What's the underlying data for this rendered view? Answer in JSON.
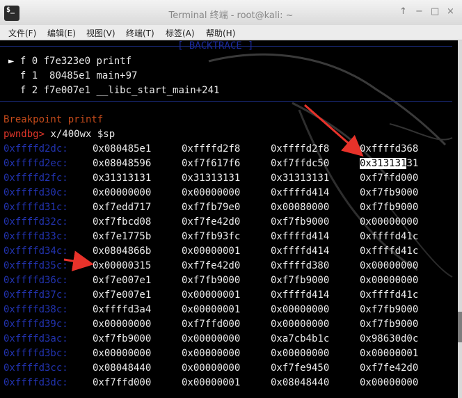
{
  "window": {
    "title": "Terminal 终端 - root@kali: ~",
    "app_icon_label": "$_",
    "controls": [
      "↑",
      "−",
      "□",
      "×"
    ]
  },
  "menu": [
    "文件(F)",
    "编辑(E)",
    "视图(V)",
    "终端(T)",
    "标签(A)",
    "帮助(H)"
  ],
  "backtrace": {
    "title": "[ BACKTRACE ]",
    "frames": [
      {
        "marker": "►",
        "text": " f 0 f7e323e0 printf"
      },
      {
        "marker": " ",
        "text": " f 1  80485e1 main+97"
      },
      {
        "marker": " ",
        "text": " f 2 f7e007e1 __libc_start_main+241"
      }
    ]
  },
  "breakpoint_text": "Breakpoint printf",
  "prompt": "pwndbg>",
  "command": " x/400wx $sp",
  "highlight": {
    "selected": "0x313131",
    "rest": "31"
  },
  "memory": [
    {
      "addr": "0xffffd2dc:",
      "words": [
        "0x080485e1",
        "0xffffd2f8",
        "0xffffd2f8",
        "0xffffd368"
      ]
    },
    {
      "addr": "0xffffd2ec:",
      "words": [
        "0x08048596",
        "0xf7f617f6",
        "0xf7ffdc50",
        "0x31313131"
      ]
    },
    {
      "addr": "0xffffd2fc:",
      "words": [
        "0x31313131",
        "0x31313131",
        "0x31313131",
        "0xf7ffd000"
      ]
    },
    {
      "addr": "0xffffd30c:",
      "words": [
        "0x00000000",
        "0x00000000",
        "0xffffd414",
        "0xf7fb9000"
      ]
    },
    {
      "addr": "0xffffd31c:",
      "words": [
        "0xf7edd717",
        "0xf7fb79e0",
        "0x00080000",
        "0xf7fb9000"
      ]
    },
    {
      "addr": "0xffffd32c:",
      "words": [
        "0xf7fbcd08",
        "0xf7fe42d0",
        "0xf7fb9000",
        "0x00000000"
      ]
    },
    {
      "addr": "0xffffd33c:",
      "words": [
        "0xf7e1775b",
        "0xf7fb93fc",
        "0xffffd414",
        "0xffffd41c"
      ]
    },
    {
      "addr": "0xffffd34c:",
      "words": [
        "0x0804866b",
        "0x00000001",
        "0xffffd414",
        "0xffffd41c"
      ]
    },
    {
      "addr": "0xffffd35c:",
      "words": [
        "0x00000315",
        "0xf7fe42d0",
        "0xffffd380",
        "0x00000000"
      ]
    },
    {
      "addr": "0xffffd36c:",
      "words": [
        "0xf7e007e1",
        "0xf7fb9000",
        "0xf7fb9000",
        "0x00000000"
      ]
    },
    {
      "addr": "0xffffd37c:",
      "words": [
        "0xf7e007e1",
        "0x00000001",
        "0xffffd414",
        "0xffffd41c"
      ]
    },
    {
      "addr": "0xffffd38c:",
      "words": [
        "0xffffd3a4",
        "0x00000001",
        "0x00000000",
        "0xf7fb9000"
      ]
    },
    {
      "addr": "0xffffd39c:",
      "words": [
        "0x00000000",
        "0xf7ffd000",
        "0x00000000",
        "0xf7fb9000"
      ]
    },
    {
      "addr": "0xffffd3ac:",
      "words": [
        "0xf7fb9000",
        "0x00000000",
        "0xa7cb4b1c",
        "0x98630d0c"
      ]
    },
    {
      "addr": "0xffffd3bc:",
      "words": [
        "0x00000000",
        "0x00000000",
        "0x00000000",
        "0x00000001"
      ]
    },
    {
      "addr": "0xffffd3cc:",
      "words": [
        "0x08048440",
        "0x00000000",
        "0xf7fe9450",
        "0xf7fe42d0"
      ]
    },
    {
      "addr": "0xffffd3dc:",
      "words": [
        "0xf7ffd000",
        "0x00000001",
        "0x08048440",
        "0x00000000"
      ]
    }
  ],
  "colors": {
    "address": "#2233b0",
    "breakpoint": "#c44a1a",
    "prompt": "#e0362a",
    "annotation_arrow": "#e8322a"
  }
}
